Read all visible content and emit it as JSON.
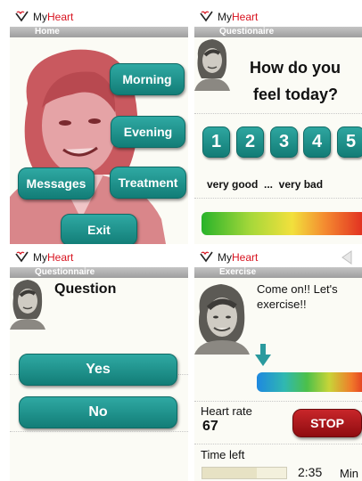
{
  "brand": {
    "my": "My",
    "heart": "Heart"
  },
  "colors": {
    "teal": "#1a8b85",
    "heart_red": "#d8121e",
    "stop_red": "#a80f14",
    "portrait_tint": "#d9868a"
  },
  "home": {
    "title": "Home",
    "buttons": {
      "morning": "Morning",
      "evening": "Evening",
      "messages": "Messages",
      "treatment": "Treatment",
      "exit": "Exit"
    }
  },
  "questionnaire_scale": {
    "title": "Questionaire",
    "question_line1": "How do you",
    "question_line2": "feel today?",
    "options": [
      "1",
      "2",
      "3",
      "4",
      "5"
    ],
    "scale_label": "very good  ...  very bad"
  },
  "questionnaire_yesno": {
    "title": "Questionnaire",
    "heading": "Question",
    "yes": "Yes",
    "no": "No"
  },
  "exercise": {
    "title": "Exercise",
    "message_line1": "Come on!! Let's",
    "message_line2": "exercise!!",
    "heart_rate_label": "Heart rate",
    "heart_rate_value": "67",
    "stop": "STOP",
    "time_left_label": "Time left",
    "time_value": "2:35",
    "time_unit": "Min",
    "time_progress": 0.65
  }
}
